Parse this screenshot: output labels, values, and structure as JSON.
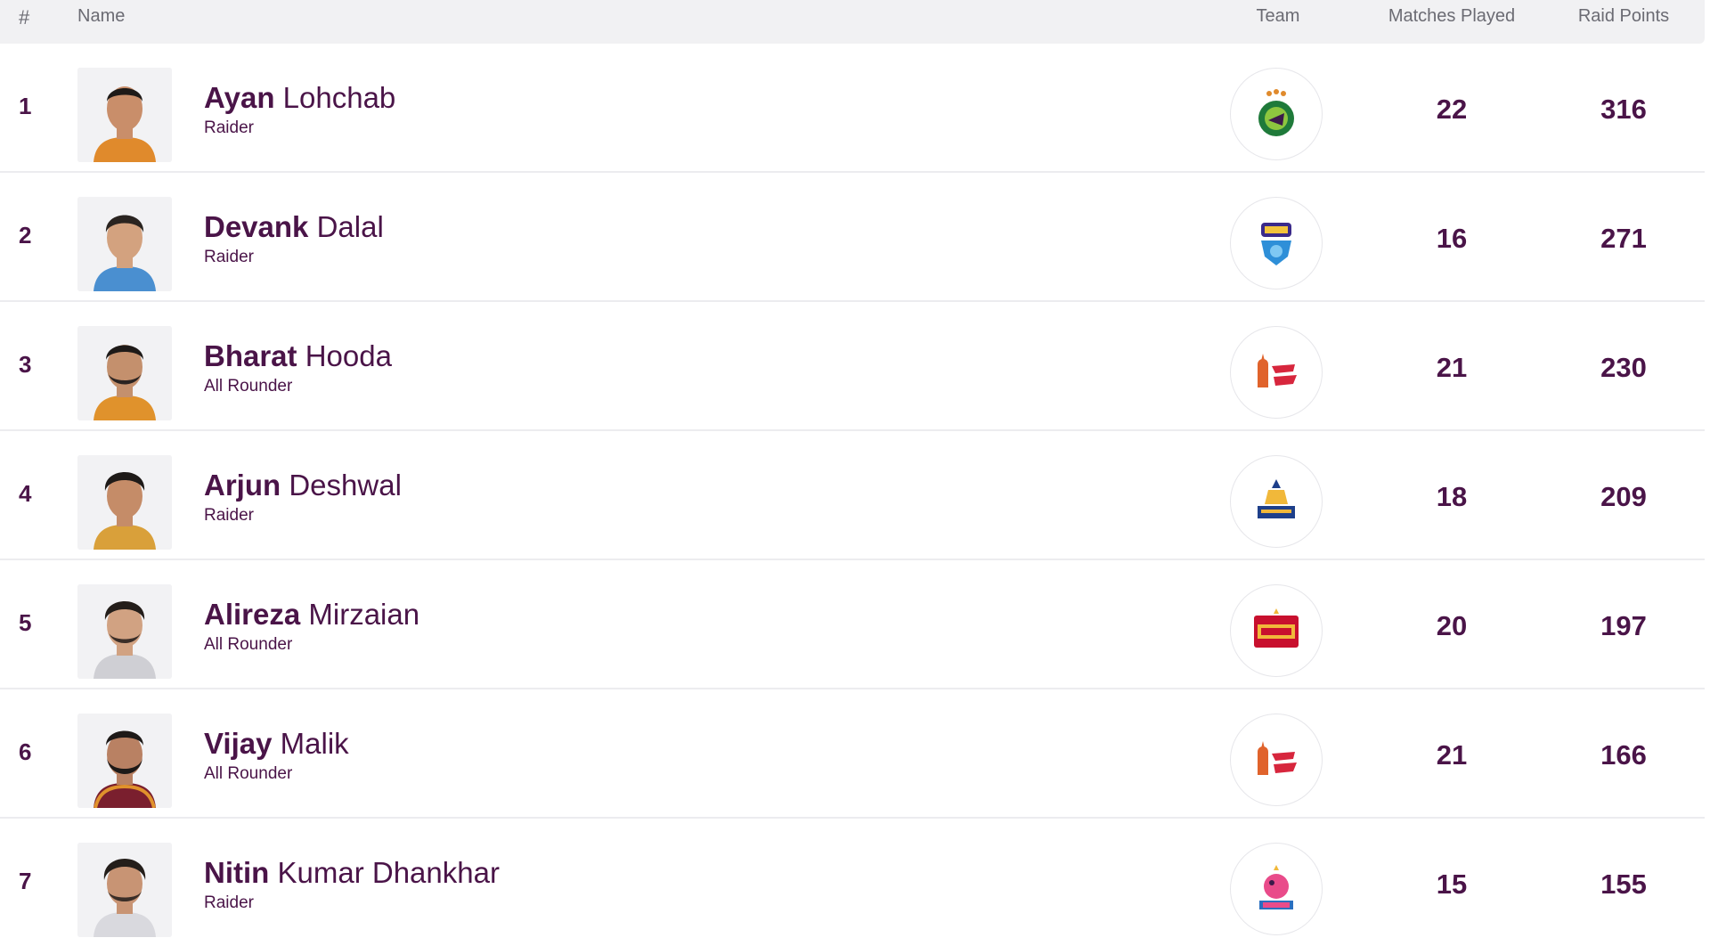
{
  "header": {
    "rank_label": "#",
    "name_label": "Name",
    "team_label": "Team",
    "matches_label": "Matches Played",
    "raid_label": "Raid Points"
  },
  "colors": {
    "text_primary": "#4a1448",
    "header_bg": "#f1f1f3",
    "header_text": "#6b6b73",
    "divider": "#ececef"
  },
  "players": [
    {
      "rank": "1",
      "first": "Ayan",
      "last": "Lohchab",
      "role": "Raider",
      "team_logo": "patna-pirates-logo",
      "matches": "22",
      "raid_points": "316"
    },
    {
      "rank": "2",
      "first": "Devank",
      "last": "Dalal",
      "role": "Raider",
      "team_logo": "bengal-warriorz-logo",
      "matches": "16",
      "raid_points": "271"
    },
    {
      "rank": "3",
      "first": "Bharat",
      "last": "Hooda",
      "role": "All Rounder",
      "team_logo": "up-yoddhas-logo",
      "matches": "21",
      "raid_points": "230"
    },
    {
      "rank": "4",
      "first": "Arjun",
      "last": "Deshwal",
      "role": "Raider",
      "team_logo": "tamil-thalaivas-logo",
      "matches": "18",
      "raid_points": "209"
    },
    {
      "rank": "5",
      "first": "Alireza",
      "last": "Mirzaian",
      "role": "All Rounder",
      "team_logo": "bengaluru-bulls-logo",
      "matches": "20",
      "raid_points": "197"
    },
    {
      "rank": "6",
      "first": "Vijay",
      "last": "Malik",
      "role": "All Rounder",
      "team_logo": "up-yoddhas-logo",
      "matches": "21",
      "raid_points": "166"
    },
    {
      "rank": "7",
      "first": "Nitin",
      "last": "Kumar Dhankhar",
      "role": "Raider",
      "team_logo": "jaipur-pink-panthers-logo",
      "matches": "15",
      "raid_points": "155"
    }
  ]
}
